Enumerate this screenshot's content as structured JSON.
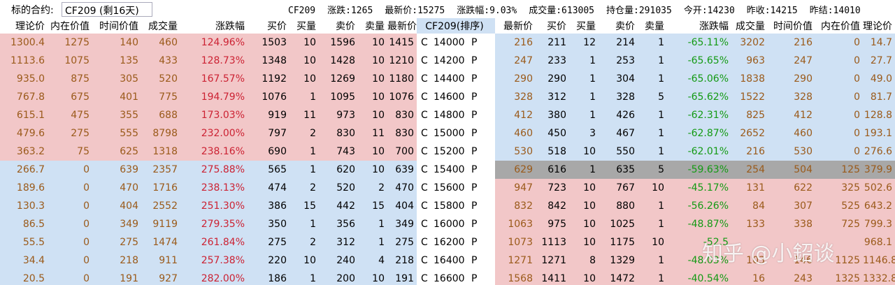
{
  "topbar": {
    "label": "标的合约:",
    "contract_value": "CF209 (剩16天)",
    "stats": [
      "CF209",
      "涨跌:1265",
      "最新价:15275",
      "涨跌幅:9.03%",
      "成交量:613005",
      "持仓量:291035",
      "今开:14230",
      "昨收:14215",
      "昨结:14010"
    ]
  },
  "headers": {
    "call": [
      "理论价",
      "内在价值",
      "时间价值",
      "成交量",
      "涨跌幅",
      "买价",
      "买量",
      "卖价",
      "卖量",
      "最新价"
    ],
    "middle": "CF209(排序)",
    "put": [
      "最新价",
      "买价",
      "买量",
      "卖价",
      "卖量",
      "涨跌幅",
      "成交量",
      "时间价值",
      "内在价值",
      "理论价"
    ]
  },
  "rows": [
    {
      "call": [
        "1300.4",
        "1275",
        "140",
        "460",
        "124.96%",
        "1503",
        "10",
        "1596",
        "10",
        "1415"
      ],
      "c": "C",
      "strike": "14000",
      "p": "P",
      "put": [
        "216",
        "211",
        "12",
        "214",
        "1",
        "-65.11%",
        "3202",
        "216",
        "0",
        "14.7"
      ],
      "call_bg": "pink",
      "put_bg": "blue"
    },
    {
      "call": [
        "1113.6",
        "1075",
        "135",
        "433",
        "128.73%",
        "1348",
        "10",
        "1428",
        "10",
        "1210"
      ],
      "c": "C",
      "strike": "14200",
      "p": "P",
      "put": [
        "247",
        "233",
        "1",
        "253",
        "1",
        "-65.65%",
        "963",
        "247",
        "0",
        "27.7"
      ],
      "call_bg": "pink",
      "put_bg": "blue"
    },
    {
      "call": [
        "935.0",
        "875",
        "305",
        "520",
        "167.57%",
        "1192",
        "10",
        "1269",
        "10",
        "1180"
      ],
      "c": "C",
      "strike": "14400",
      "p": "P",
      "put": [
        "290",
        "290",
        "1",
        "304",
        "1",
        "-65.06%",
        "1838",
        "290",
        "0",
        "49.0"
      ],
      "call_bg": "pink",
      "put_bg": "blue"
    },
    {
      "call": [
        "767.8",
        "675",
        "401",
        "775",
        "194.79%",
        "1076",
        "1",
        "1095",
        "10",
        "1076"
      ],
      "c": "C",
      "strike": "14600",
      "p": "P",
      "put": [
        "328",
        "312",
        "1",
        "328",
        "5",
        "-65.62%",
        "1522",
        "328",
        "0",
        "81.7"
      ],
      "call_bg": "pink",
      "put_bg": "blue"
    },
    {
      "call": [
        "615.1",
        "475",
        "355",
        "688",
        "173.03%",
        "919",
        "11",
        "973",
        "10",
        "830"
      ],
      "c": "C",
      "strike": "14800",
      "p": "P",
      "put": [
        "412",
        "380",
        "1",
        "426",
        "1",
        "-62.31%",
        "825",
        "412",
        "0",
        "128.8"
      ],
      "call_bg": "pink",
      "put_bg": "blue"
    },
    {
      "call": [
        "479.6",
        "275",
        "555",
        "8798",
        "232.00%",
        "797",
        "2",
        "830",
        "11",
        "830"
      ],
      "c": "C",
      "strike": "15000",
      "p": "P",
      "put": [
        "460",
        "450",
        "3",
        "467",
        "1",
        "-62.87%",
        "2652",
        "460",
        "0",
        "193.1"
      ],
      "call_bg": "pink",
      "put_bg": "blue"
    },
    {
      "call": [
        "363.2",
        "75",
        "625",
        "1318",
        "238.16%",
        "690",
        "1",
        "743",
        "10",
        "700"
      ],
      "c": "C",
      "strike": "15200",
      "p": "P",
      "put": [
        "530",
        "518",
        "10",
        "550",
        "1",
        "-62.01%",
        "216",
        "530",
        "0",
        "276.6"
      ],
      "call_bg": "pink",
      "put_bg": "blue"
    },
    {
      "call": [
        "266.7",
        "0",
        "639",
        "2357",
        "275.88%",
        "565",
        "1",
        "620",
        "10",
        "639"
      ],
      "c": "C",
      "strike": "15400",
      "p": "P",
      "put": [
        "629",
        "616",
        "1",
        "635",
        "5",
        "-59.63%",
        "254",
        "504",
        "125",
        "379.9"
      ],
      "call_bg": "blue",
      "put_bg": "gray"
    },
    {
      "call": [
        "189.6",
        "0",
        "470",
        "1716",
        "238.13%",
        "474",
        "2",
        "520",
        "2",
        "470"
      ],
      "c": "C",
      "strike": "15600",
      "p": "P",
      "put": [
        "947",
        "723",
        "10",
        "767",
        "10",
        "-45.17%",
        "131",
        "622",
        "325",
        "502.6"
      ],
      "call_bg": "blue",
      "put_bg": "pink"
    },
    {
      "call": [
        "130.3",
        "0",
        "404",
        "2552",
        "251.30%",
        "386",
        "15",
        "442",
        "15",
        "404"
      ],
      "c": "C",
      "strike": "15800",
      "p": "P",
      "put": [
        "832",
        "842",
        "10",
        "880",
        "1",
        "-56.26%",
        "84",
        "307",
        "525",
        "643.2"
      ],
      "call_bg": "blue",
      "put_bg": "pink"
    },
    {
      "call": [
        "86.5",
        "0",
        "349",
        "9119",
        "279.35%",
        "350",
        "1",
        "356",
        "1",
        "349"
      ],
      "c": "C",
      "strike": "16000",
      "p": "P",
      "put": [
        "1063",
        "975",
        "10",
        "1025",
        "1",
        "-48.87%",
        "133",
        "338",
        "725",
        "799.3"
      ],
      "call_bg": "blue",
      "put_bg": "pink"
    },
    {
      "call": [
        "55.5",
        "0",
        "275",
        "1474",
        "261.84%",
        "275",
        "2",
        "312",
        "1",
        "275"
      ],
      "c": "C",
      "strike": "16200",
      "p": "P",
      "put": [
        "1073",
        "1113",
        "10",
        "1175",
        "10",
        "-52.5",
        "",
        "",
        "",
        "968.1"
      ],
      "call_bg": "blue",
      "put_bg": "pink"
    },
    {
      "call": [
        "34.4",
        "0",
        "218",
        "911",
        "257.38%",
        "220",
        "10",
        "240",
        "4",
        "218"
      ],
      "c": "C",
      "strike": "16400",
      "p": "P",
      "put": [
        "1271",
        "1271",
        "8",
        "1329",
        "1",
        "-48.03%",
        "103",
        "146",
        "1125",
        "1146.8"
      ],
      "call_bg": "blue",
      "put_bg": "pink"
    },
    {
      "call": [
        "20.5",
        "0",
        "191",
        "927",
        "282.00%",
        "186",
        "1",
        "200",
        "10",
        "191"
      ],
      "c": "C",
      "strike": "16600",
      "p": "P",
      "put": [
        "1568",
        "1411",
        "10",
        "1472",
        "1",
        "-40.54%",
        "16",
        "243",
        "1325",
        "1332.8"
      ],
      "call_bg": "blue",
      "put_bg": "pink"
    }
  ],
  "watermark": "知乎 @小鉊谈",
  "colors": {
    "pink": "#f2c7c8",
    "blue": "#cfe1f4",
    "gray": "#a8a8a8",
    "brown": "#9a5a1a",
    "red": "#cc2233",
    "green": "#149a14"
  }
}
